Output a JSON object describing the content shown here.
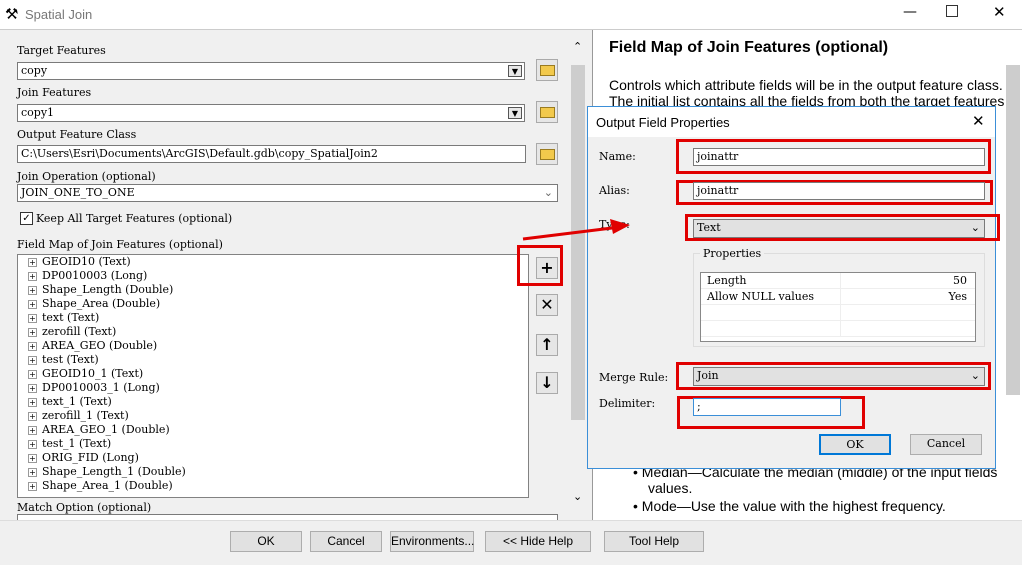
{
  "window": {
    "title": "Spatial Join",
    "icon": "hammer-icon"
  },
  "form": {
    "target_label": "Target Features",
    "target_value": "copy",
    "join_label": "Join Features",
    "join_value": "copy1",
    "output_label": "Output Feature Class",
    "output_value": "C:\\Users\\Esri\\Documents\\ArcGIS\\Default.gdb\\copy_SpatialJoin2",
    "operation_label": "Join Operation (optional)",
    "operation_value": "JOIN_ONE_TO_ONE",
    "keep_all_label": "Keep All Target Features (optional)",
    "keep_all_checked": true,
    "fieldmap_label": "Field Map of Join Features (optional)",
    "fields": [
      "GEOID10 (Text)",
      "DP0010003 (Long)",
      "Shape_Length (Double)",
      "Shape_Area (Double)",
      "text (Text)",
      "zerofill (Text)",
      "AREA_GEO (Double)",
      "test (Text)",
      "GEOID10_1 (Text)",
      "DP0010003_1 (Long)",
      "text_1 (Text)",
      "zerofill_1 (Text)",
      "AREA_GEO_1 (Double)",
      "test_1 (Text)",
      "ORIG_FID (Long)",
      "Shape_Length_1 (Double)",
      "Shape_Area_1 (Double)"
    ],
    "match_label": "Match Option (optional)"
  },
  "buttons": {
    "ok": "OK",
    "cancel": "Cancel",
    "environments": "Environments...",
    "hide_help": "<< Hide Help",
    "tool_help": "Tool Help"
  },
  "help": {
    "title": "Field Map of Join Features (optional)",
    "para1": "Controls which attribute fields will be in the output feature class.",
    "para2": "The initial list contains all the fields from both the target features",
    "bullet1a": "Median—Calculate the median (middle) of the input fields",
    "bullet1b": "values.",
    "bullet2": "Mode—Use the value with the highest frequency."
  },
  "dialog": {
    "title": "Output Field Properties",
    "name_label": "Name:",
    "name_value": "joinattr",
    "alias_label": "Alias:",
    "alias_value": "joinattr",
    "type_label": "Type:",
    "type_value": "Text",
    "properties_label": "Properties",
    "props": [
      {
        "k": "Length",
        "v": "50"
      },
      {
        "k": "Allow NULL values",
        "v": "Yes"
      }
    ],
    "merge_label": "Merge Rule:",
    "merge_value": "Join",
    "delimiter_label": "Delimiter:",
    "delimiter_value": ";",
    "ok": "OK",
    "cancel": "Cancel"
  },
  "colors": {
    "highlight": "#e00000",
    "dialog_border": "#3b8fd8"
  }
}
